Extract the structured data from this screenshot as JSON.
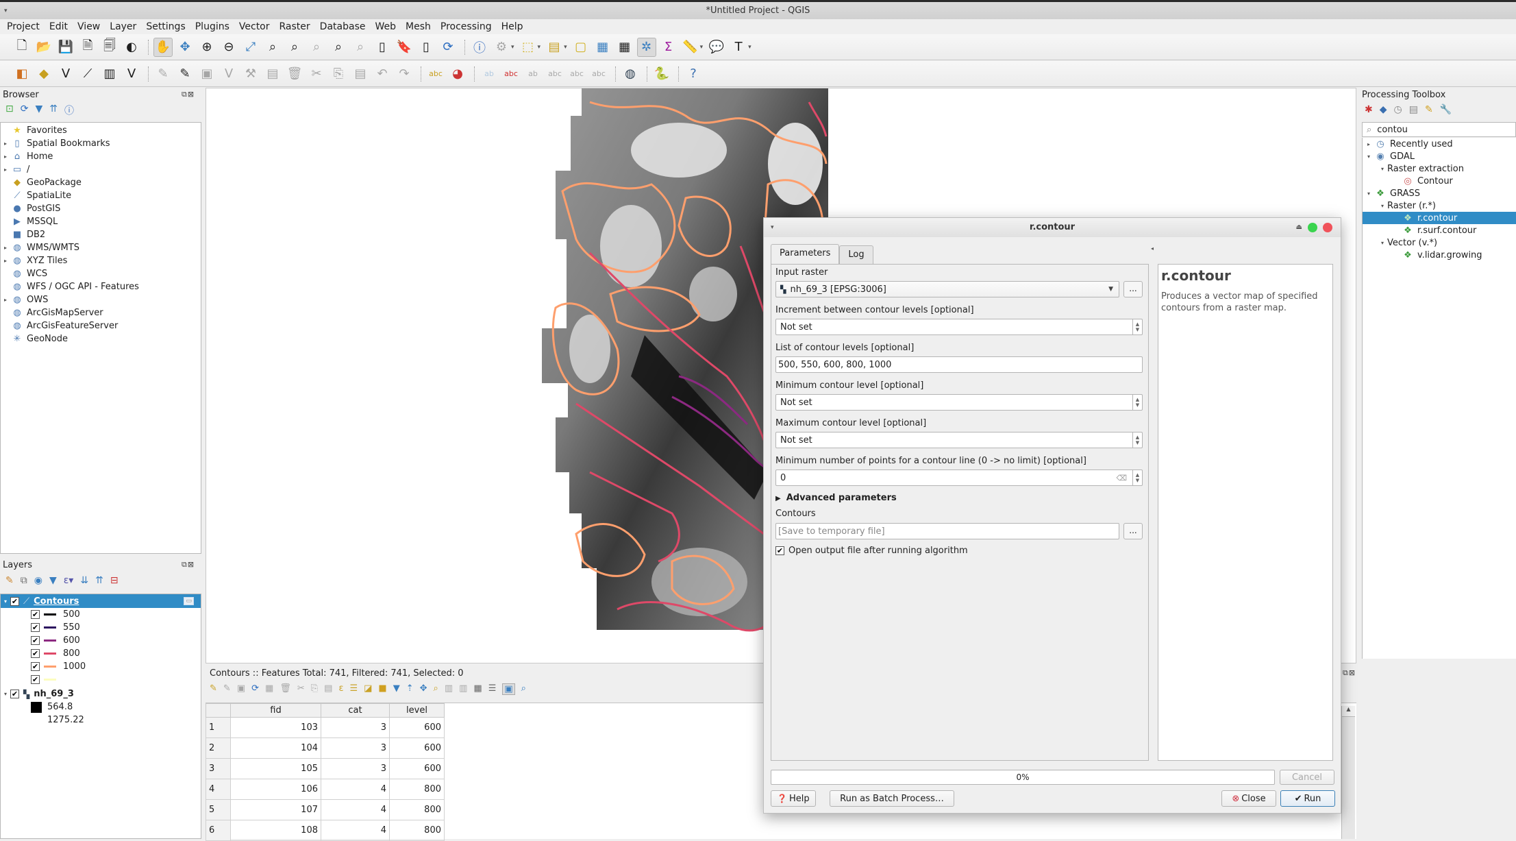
{
  "window": {
    "title": "*Untitled Project - QGIS"
  },
  "menubar": [
    "Project",
    "Edit",
    "View",
    "Layer",
    "Settings",
    "Plugins",
    "Vector",
    "Raster",
    "Database",
    "Web",
    "Mesh",
    "Processing",
    "Help"
  ],
  "toolbar1": [
    "new-project-icon",
    "open-project-icon",
    "save-project-icon",
    "new-print-layout-icon",
    "layout-manager-icon",
    "style-manager-icon",
    "pan-icon",
    "pan-to-selection-icon",
    "zoom-in-icon",
    "zoom-out-icon",
    "zoom-full-icon",
    "zoom-to-selection-icon",
    "zoom-to-layer-icon",
    "zoom-native-icon",
    "zoom-last-icon",
    "zoom-next-icon",
    "new-map-view-icon",
    "new-bookmark-icon",
    "show-bookmarks-icon",
    "refresh-icon",
    "identify-icon",
    "run-action-icon",
    "select-features-icon",
    "select-by-value-icon",
    "deselect-icon",
    "attribute-table-icon",
    "field-calculator-icon",
    "processing-toolbox-icon",
    "statistics-icon",
    "measure-icon",
    "map-tips-icon",
    "text-annotation-icon"
  ],
  "toolbar2": [
    "data-source-manager-icon",
    "new-geopackage-icon",
    "new-shapefile-icon",
    "new-spatialite-icon",
    "new-temp-scratch-icon",
    "new-virtual-layer-icon",
    "current-edits-icon",
    "toggle-editing-icon",
    "save-edits-icon",
    "digitize-icon",
    "vertex-tool-icon",
    "modify-attributes-icon",
    "delete-selected-icon",
    "cut-icon",
    "copy-icon",
    "paste-icon",
    "undo-icon",
    "redo-icon",
    "label-icon",
    "diagram-icon",
    "pin-labels-icon",
    "highlight-labels-icon",
    "move-label-icon",
    "show-hide-labels-icon",
    "rotate-label-icon",
    "change-label-icon",
    "osm-search-icon",
    "python-console-icon",
    "help-icon"
  ],
  "browser": {
    "title": "Browser",
    "items": [
      {
        "label": "Favorites",
        "icon": "star-icon",
        "glyph": "★",
        "expandable": false
      },
      {
        "label": "Spatial Bookmarks",
        "icon": "bookmark-icon",
        "glyph": "▯",
        "expandable": true
      },
      {
        "label": "Home",
        "icon": "home-folder-icon",
        "glyph": "⌂",
        "expandable": true
      },
      {
        "label": "/",
        "icon": "folder-icon",
        "glyph": "▭",
        "expandable": true
      },
      {
        "label": "GeoPackage",
        "icon": "geopackage-icon",
        "glyph": "◆",
        "expandable": false
      },
      {
        "label": "SpatiaLite",
        "icon": "spatialite-icon",
        "glyph": "⟋",
        "expandable": false
      },
      {
        "label": "PostGIS",
        "icon": "postgis-icon",
        "glyph": "●",
        "expandable": false
      },
      {
        "label": "MSSQL",
        "icon": "mssql-icon",
        "glyph": "▶",
        "expandable": false
      },
      {
        "label": "DB2",
        "icon": "db2-icon",
        "glyph": "■",
        "expandable": false
      },
      {
        "label": "WMS/WMTS",
        "icon": "globe-icon",
        "glyph": "◍",
        "expandable": true
      },
      {
        "label": "XYZ Tiles",
        "icon": "globe-icon",
        "glyph": "◍",
        "expandable": true
      },
      {
        "label": "WCS",
        "icon": "wcs-icon",
        "glyph": "◍",
        "expandable": false
      },
      {
        "label": "WFS / OGC API - Features",
        "icon": "wfs-icon",
        "glyph": "◍",
        "expandable": false
      },
      {
        "label": "OWS",
        "icon": "ows-icon",
        "glyph": "◍",
        "expandable": true
      },
      {
        "label": "ArcGisMapServer",
        "icon": "arcgis-icon",
        "glyph": "◍",
        "expandable": false
      },
      {
        "label": "ArcGisFeatureServer",
        "icon": "arcgis-icon",
        "glyph": "◍",
        "expandable": false
      },
      {
        "label": "GeoNode",
        "icon": "geonode-icon",
        "glyph": "✳",
        "expandable": false
      }
    ]
  },
  "layers": {
    "title": "Layers",
    "vector_layer": {
      "name": "Contours",
      "classes": [
        {
          "label": "500",
          "color": "#000004",
          "checked": true
        },
        {
          "label": "550",
          "color": "#2c115f",
          "checked": true
        },
        {
          "label": "600",
          "color": "#8c2981",
          "checked": true
        },
        {
          "label": "800",
          "color": "#de4968",
          "checked": true
        },
        {
          "label": "1000",
          "color": "#fe9f6d",
          "checked": true
        },
        {
          "label": "",
          "color": "#fcfdbf",
          "checked": true
        }
      ]
    },
    "raster_layer": {
      "name": "nh_69_3",
      "min": "564.8",
      "max": "1275.22"
    }
  },
  "attribute_table": {
    "status": "Contours :: Features Total: 741, Filtered: 741, Selected: 0",
    "columns": [
      "fid",
      "cat",
      "level"
    ],
    "rows": [
      {
        "n": "1",
        "fid": "103",
        "cat": "3",
        "level": "600"
      },
      {
        "n": "2",
        "fid": "104",
        "cat": "3",
        "level": "600"
      },
      {
        "n": "3",
        "fid": "105",
        "cat": "3",
        "level": "600"
      },
      {
        "n": "4",
        "fid": "106",
        "cat": "4",
        "level": "800"
      },
      {
        "n": "5",
        "fid": "107",
        "cat": "4",
        "level": "800"
      },
      {
        "n": "6",
        "fid": "108",
        "cat": "4",
        "level": "800"
      }
    ]
  },
  "processing": {
    "title": "Processing Toolbox",
    "search": "contou",
    "tree": [
      {
        "label": "Recently used",
        "level": 0,
        "arrow": "▸",
        "glyph": "◷",
        "icon": "clock-icon"
      },
      {
        "label": "GDAL",
        "level": 0,
        "arrow": "▾",
        "glyph": "◉",
        "icon": "gdal-icon"
      },
      {
        "label": "Raster extraction",
        "level": 1,
        "arrow": "▾",
        "glyph": "",
        "icon": ""
      },
      {
        "label": "Contour",
        "level": 2,
        "arrow": "",
        "glyph": "◎",
        "icon": "contour-icon"
      },
      {
        "label": "GRASS",
        "level": 0,
        "arrow": "▾",
        "glyph": "❖",
        "icon": "grass-icon"
      },
      {
        "label": "Raster (r.*)",
        "level": 1,
        "arrow": "▾",
        "glyph": "",
        "icon": ""
      },
      {
        "label": "r.contour",
        "level": 2,
        "arrow": "",
        "glyph": "❖",
        "icon": "grass-icon",
        "selected": true
      },
      {
        "label": "r.surf.contour",
        "level": 2,
        "arrow": "",
        "glyph": "❖",
        "icon": "grass-icon"
      },
      {
        "label": "Vector (v.*)",
        "level": 1,
        "arrow": "▾",
        "glyph": "",
        "icon": ""
      },
      {
        "label": "v.lidar.growing",
        "level": 2,
        "arrow": "",
        "glyph": "❖",
        "icon": "grass-icon"
      }
    ]
  },
  "dialog": {
    "title": "r.contour",
    "tabs": [
      "Parameters",
      "Log"
    ],
    "params": {
      "input_raster_label": "Input raster",
      "input_raster_value": "nh_69_3 [EPSG:3006]",
      "increment_label": "Increment between contour levels [optional]",
      "increment_value": "Not set",
      "levels_label": "List of contour levels [optional]",
      "levels_value": "500, 550, 600, 800, 1000",
      "min_label": "Minimum contour level [optional]",
      "min_value": "Not set",
      "max_label": "Maximum contour level [optional]",
      "max_value": "Not set",
      "cut_label": "Minimum number of points for a contour line (0 -> no limit) [optional]",
      "cut_value": "0",
      "advanced_label": "Advanced parameters",
      "output_label": "Contours",
      "output_placeholder": "[Save to temporary file]",
      "open_output_label": "Open output file after running algorithm",
      "open_output_checked": true,
      "browse_label": "..."
    },
    "help": {
      "title": "r.contour",
      "description": "Produces a vector map of specified contours from a raster map."
    },
    "progress": {
      "value": 0,
      "label": "0%"
    },
    "buttons": {
      "cancel": "Cancel",
      "help": "Help",
      "batch": "Run as Batch Process…",
      "close": "Close",
      "run": "Run"
    },
    "colors": {
      "close_dot": "#f0525a",
      "max_dot": "#3ad44e"
    }
  }
}
